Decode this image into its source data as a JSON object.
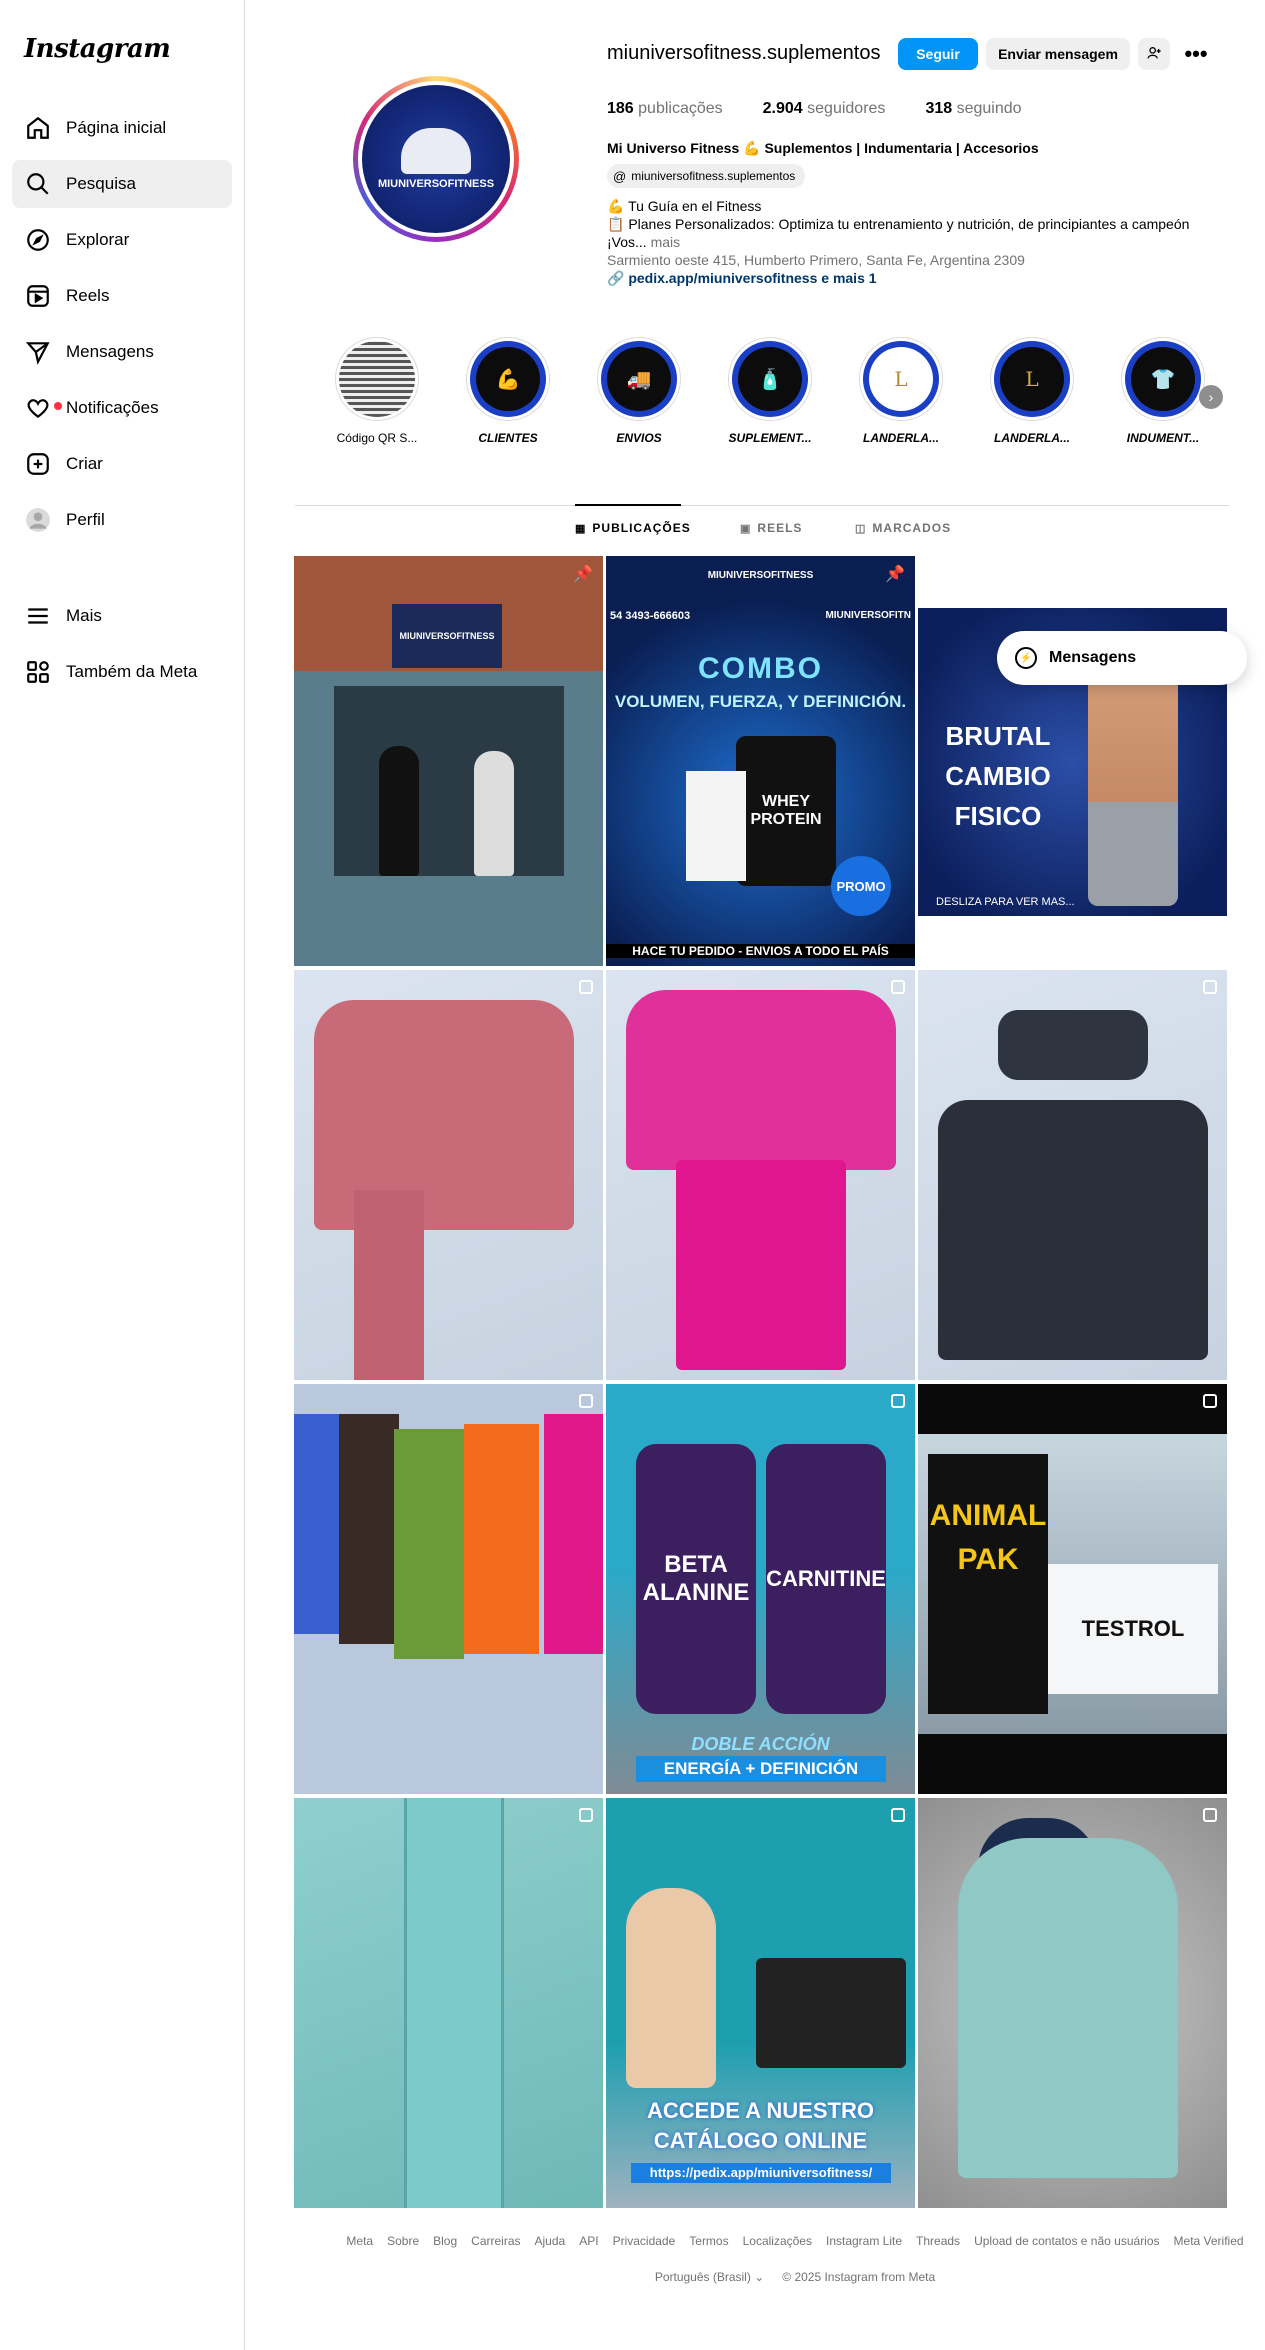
{
  "app": {
    "logo": "Instagram"
  },
  "sidebar": {
    "items": [
      {
        "label": "Página inicial",
        "icon": "home-icon"
      },
      {
        "label": "Pesquisa",
        "icon": "search-icon"
      },
      {
        "label": "Explorar",
        "icon": "compass-icon"
      },
      {
        "label": "Reels",
        "icon": "reels-icon"
      },
      {
        "label": "Mensagens",
        "icon": "send-icon"
      },
      {
        "label": "Notificações",
        "icon": "heart-icon"
      },
      {
        "label": "Criar",
        "icon": "plus-square-icon"
      },
      {
        "label": "Perfil",
        "icon": "avatar-icon"
      },
      {
        "label": "Mais",
        "icon": "menu-icon"
      },
      {
        "label": "Também da Meta",
        "icon": "meta-apps-icon"
      }
    ]
  },
  "profile": {
    "username": "miuniversofitness.suplementos",
    "follow_label": "Seguir",
    "message_label": "Enviar mensagem",
    "avatar_text": "MIUNIVERSOFITNESS",
    "stats": {
      "posts_num": "186",
      "posts_label": "publicações",
      "followers_num": "2.904",
      "followers_label": "seguidores",
      "following_num": "318",
      "following_label": "seguindo"
    },
    "bio": {
      "name": "Mi Universo Fitness 💪 Suplementos | Indumentaria | Accesorios",
      "threads": "miuniversofitness.suplementos",
      "line1": "💪 Tu Guía en el Fitness",
      "line2": "📋 Planes Personalizados: Optimiza tu entrenamiento y nutrición, de principiantes a campeón",
      "line3": "¡Vos...",
      "more": "mais",
      "address": "Sarmiento oeste 415, Humberto Primero, Santa Fe, Argentina 2309",
      "link": "pedix.app/miuniversofitness e mais 1"
    }
  },
  "highlights": [
    {
      "label": "Código QR S..."
    },
    {
      "label": "CLIENTES"
    },
    {
      "label": "ENVIOS"
    },
    {
      "label": "SUPLEMENT..."
    },
    {
      "label": "LANDERLA..."
    },
    {
      "label": "LANDERLA..."
    },
    {
      "label": "INDUMENT..."
    }
  ],
  "tabs": [
    {
      "label": "PUBLICAÇÕES"
    },
    {
      "label": "REELS"
    },
    {
      "label": "MARCADOS"
    }
  ],
  "posts": {
    "p1_sign": "MIUNIVERSOFITNESS",
    "p2_brand": "MIUNIVERSOFITNESS",
    "p2_phone": "54 3493-666603",
    "p2_handle": "MIUNIVERSOFITN",
    "p2_title": "COMBO",
    "p2_sub": "VOLUMEN, FUERZA, Y DEFINICIÓN.",
    "p2_product": "WHEY PROTEIN",
    "p2_promo": "PROMO",
    "p2_footer": "HACE TU PEDIDO - ENVIOS A TODO EL PAÍS",
    "p3_title": "BRUTAL CAMBIO FISICO",
    "p3_footer": "DESLIZA PARA VER MAS...",
    "p8_left": "BETA ALANINE",
    "p8_right": "CARNITINE",
    "p8_line1": "DOBLE ACCIÓN",
    "p8_line2": "ENERGÍA + DEFINICIÓN",
    "p9_left": "ANIMAL PAK",
    "p9_right": "TESTROL",
    "p11_line1": "ACCEDE A NUESTRO",
    "p11_line2": "CATÁLOGO ONLINE",
    "p11_url": "https://pedix.app/miuniversofitness/"
  },
  "floating": {
    "label": "Mensagens"
  },
  "footer": {
    "links": [
      "Meta",
      "Sobre",
      "Blog",
      "Carreiras",
      "Ajuda",
      "API",
      "Privacidade",
      "Termos",
      "Localizações",
      "Instagram Lite",
      "Threads",
      "Upload de contatos e não usuários",
      "Meta Verified"
    ],
    "language": "Português (Brasil)",
    "copyright": "© 2025 Instagram from Meta"
  },
  "colors": {
    "accent": "#0095f6",
    "highlight_ring": "#1a3fc4"
  }
}
